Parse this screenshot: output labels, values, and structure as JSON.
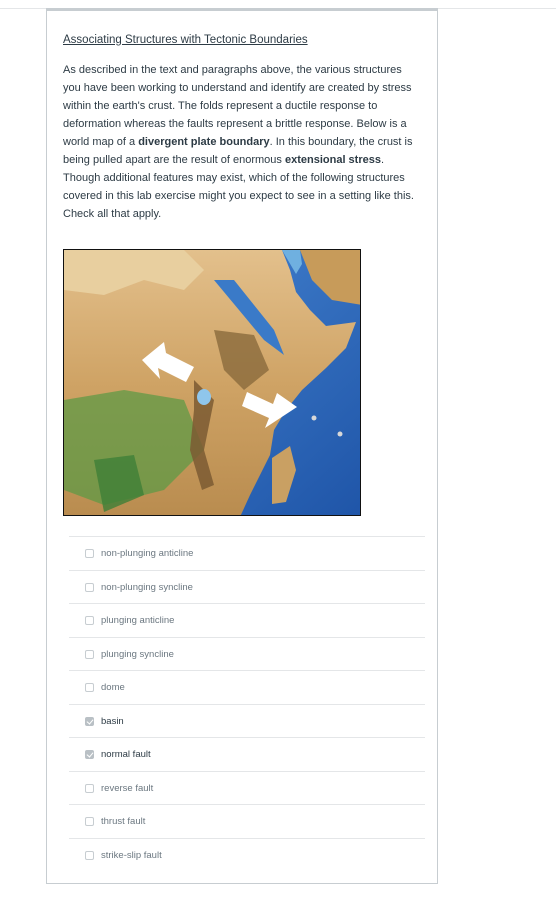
{
  "question": {
    "title": "Associating Structures with Tectonic Boundaries",
    "paragraph_parts": [
      "As described in the text and paragraphs above, the various structures you have been working to understand and identify are created by stress within the earth's crust. The folds represent a ductile response to deformation whereas the faults represent a brittle response. Below is a world map of a ",
      "divergent plate boundary",
      ". In this boundary, the crust is being pulled apart are the result of enormous ",
      "extensional stress",
      ". Though additional features may exist, which of the following structures covered in this lab exercise might you expect to see in a setting like this. Check all that apply."
    ]
  },
  "map_icon": "terrain-map-east-africa-rift",
  "colors": {
    "land": "#d9b27a",
    "highland": "#8a6a3c",
    "ocean": "#2f6fc4",
    "arrow": "#ffffff"
  },
  "options": [
    {
      "label": "non-plunging anticline",
      "checked": false
    },
    {
      "label": "non-plunging syncline",
      "checked": false
    },
    {
      "label": "plunging anticline",
      "checked": false
    },
    {
      "label": "plunging syncline",
      "checked": false
    },
    {
      "label": "dome",
      "checked": false
    },
    {
      "label": "basin",
      "checked": true
    },
    {
      "label": "normal fault",
      "checked": true
    },
    {
      "label": "reverse fault",
      "checked": false
    },
    {
      "label": "thrust fault",
      "checked": false
    },
    {
      "label": "strike-slip fault",
      "checked": false
    }
  ]
}
